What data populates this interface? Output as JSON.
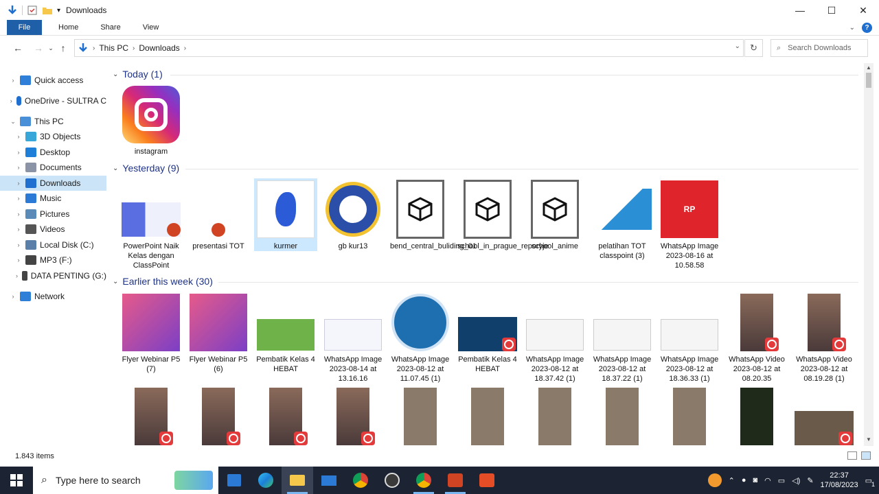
{
  "window": {
    "title": "Downloads"
  },
  "ribbon": {
    "tabs": [
      "File",
      "Home",
      "Share",
      "View"
    ],
    "help": "?"
  },
  "address": {
    "parts": [
      "This PC",
      "Downloads"
    ]
  },
  "search": {
    "placeholder": "Search Downloads"
  },
  "sidebar": {
    "items": [
      {
        "label": "Quick access",
        "icon": "star-icon",
        "level": 0,
        "expanded": false
      },
      {
        "label": "OneDrive - SULTRA C",
        "icon": "cloud-icon",
        "level": 0,
        "expanded": false
      },
      {
        "label": "This PC",
        "icon": "pc-icon",
        "level": 0,
        "expanded": true
      },
      {
        "label": "3D Objects",
        "icon": "cube-icon",
        "level": 1,
        "expanded": false
      },
      {
        "label": "Desktop",
        "icon": "desktop-icon",
        "level": 1,
        "expanded": false
      },
      {
        "label": "Documents",
        "icon": "document-icon",
        "level": 1,
        "expanded": false
      },
      {
        "label": "Downloads",
        "icon": "download-icon",
        "level": 1,
        "expanded": false,
        "selected": true
      },
      {
        "label": "Music",
        "icon": "music-icon",
        "level": 1,
        "expanded": false
      },
      {
        "label": "Pictures",
        "icon": "pictures-icon",
        "level": 1,
        "expanded": false
      },
      {
        "label": "Videos",
        "icon": "video-icon",
        "level": 1,
        "expanded": false
      },
      {
        "label": "Local Disk (C:)",
        "icon": "disk-icon",
        "level": 1,
        "expanded": false
      },
      {
        "label": "MP3 (F:)",
        "icon": "drive-icon",
        "level": 1,
        "expanded": false
      },
      {
        "label": "DATA PENTING (G:)",
        "icon": "drive-icon",
        "level": 1,
        "expanded": false
      },
      {
        "label": "Network",
        "icon": "network-icon",
        "level": 0,
        "expanded": false
      }
    ]
  },
  "groups": [
    {
      "label": "Today (1)",
      "items": [
        {
          "name": "instagram",
          "kind": "instagram"
        }
      ]
    },
    {
      "label": "Yesterday (9)",
      "items": [
        {
          "name": "PowerPoint Naik Kelas dengan ClassPoint",
          "kind": "ppt-doc"
        },
        {
          "name": "presentasi TOT",
          "kind": "ppt"
        },
        {
          "name": "kurmer",
          "kind": "kurmer"
        },
        {
          "name": "gb kur13",
          "kind": "kur13"
        },
        {
          "name": "bend_central_buliding_01",
          "kind": "3d"
        },
        {
          "name": "school_in_prague_reporyje",
          "kind": "3d"
        },
        {
          "name": "school_anime",
          "kind": "3d"
        },
        {
          "name": "pelatihan TOT classpoint (3)",
          "kind": "tot"
        },
        {
          "name": "WhatsApp Image 2023-08-16 at 10.58.58",
          "kind": "promo"
        }
      ]
    },
    {
      "label": "Earlier this week (30)",
      "items": [
        {
          "name": "Flyer Webinar P5 (7)",
          "kind": "flyer"
        },
        {
          "name": "Flyer Webinar P5 (6)",
          "kind": "flyer"
        },
        {
          "name": "Pembatik Kelas 4 HEBAT",
          "kind": "green"
        },
        {
          "name": "WhatsApp Image 2023-08-14 at 13.16.16",
          "kind": "slide"
        },
        {
          "name": "WhatsApp Image 2023-08-12 at 11.07.45 (1)",
          "kind": "mentor"
        },
        {
          "name": "Pembatik Kelas 4 HEBAT",
          "kind": "video-blue"
        },
        {
          "name": "WhatsApp Image 2023-08-12 at 18.37.42 (1)",
          "kind": "screen"
        },
        {
          "name": "WhatsApp Image 2023-08-12 at 18.37.22 (1)",
          "kind": "screen"
        },
        {
          "name": "WhatsApp Image 2023-08-12 at 18.36.33 (1)",
          "kind": "screen"
        },
        {
          "name": "WhatsApp Video 2023-08-12 at 08.20.35",
          "kind": "person-vid"
        },
        {
          "name": "WhatsApp Video 2023-08-12 at 08.19.28 (1)",
          "kind": "person-vid"
        }
      ]
    }
  ],
  "row4": [
    "person-vid",
    "person-vid",
    "person-vid",
    "person-vid",
    "table",
    "table",
    "table",
    "table",
    "table",
    "board",
    "class-vid"
  ],
  "status": {
    "count": "1.843 items"
  },
  "taskbar": {
    "search_placeholder": "Type here to search",
    "time": "22:37",
    "date": "17/08/2023",
    "notif": "1"
  }
}
